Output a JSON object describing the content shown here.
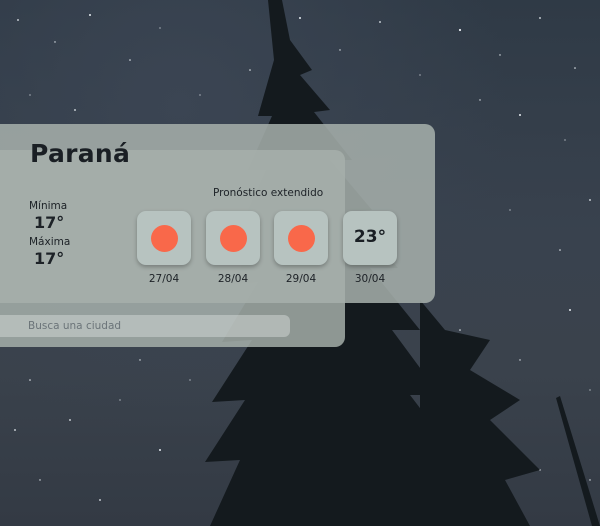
{
  "weather": {
    "city": "Paraná",
    "min_label": "Mínima",
    "min_value": "17°",
    "max_label": "Máxima",
    "max_value": "17°"
  },
  "forecast": {
    "title": "Pronóstico extendido",
    "days": [
      {
        "date": "27/04",
        "icon": "sun-icon"
      },
      {
        "date": "28/04",
        "icon": "sun-icon"
      },
      {
        "date": "29/04",
        "icon": "sun-icon"
      },
      {
        "date": "30/04",
        "temp": "23°"
      }
    ]
  },
  "search": {
    "placeholder": "Busca una ciudad"
  },
  "colors": {
    "sun": "#f9684a",
    "card": "#a6b0ab",
    "tile": "#b7c3c0"
  }
}
